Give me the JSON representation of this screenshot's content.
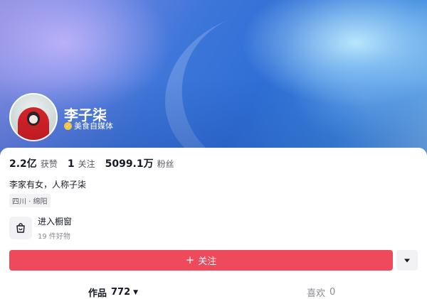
{
  "profile": {
    "name": "李子柒",
    "verify_label": "美食自媒体",
    "bio": "李家有女，人称子柒",
    "location_tag": "四川 · 绵阳"
  },
  "stats": [
    {
      "value": "2.2亿",
      "label": "获赞"
    },
    {
      "value": "1",
      "label": "关注"
    },
    {
      "value": "5099.1万",
      "label": "粉丝"
    }
  ],
  "shop": {
    "title": "进入橱窗",
    "subtitle": "19 件好物"
  },
  "actions": {
    "follow_plus": "+",
    "follow_label": "关注"
  },
  "tabs": {
    "works": {
      "label": "作品",
      "count": "772"
    },
    "likes": {
      "label": "喜欢",
      "count": "0"
    }
  },
  "colors": {
    "follow_button": "#ee4a5c",
    "verify_badge": "#f5c542",
    "banner_primary": "#2f6fd6"
  },
  "icons": {
    "verify": "verified-badge-icon",
    "shop": "shopping-bag-icon",
    "more": "chevron-down-icon",
    "tab_caret": "caret-down-icon"
  }
}
